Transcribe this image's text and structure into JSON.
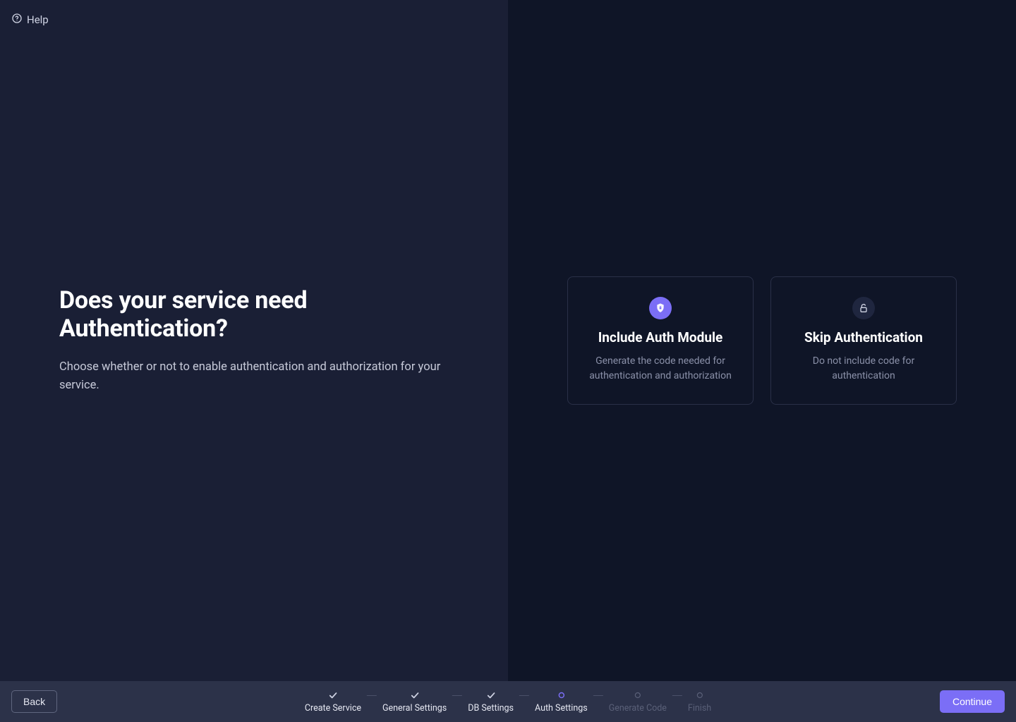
{
  "help": {
    "label": "Help"
  },
  "left_panel": {
    "heading": "Does your service need Authentication?",
    "subheading": "Choose whether or not to enable authentication and authorization for  your service."
  },
  "options": {
    "include": {
      "title": "Include Auth Module",
      "desc": "Generate the code needed for authentication and authorization"
    },
    "skip": {
      "title": "Skip Authentication",
      "desc": "Do not include code for authentication"
    }
  },
  "footer": {
    "back_label": "Back",
    "continue_label": "Continue"
  },
  "steps": [
    {
      "label": "Create Service",
      "state": "done"
    },
    {
      "label": "General Settings",
      "state": "done"
    },
    {
      "label": "DB Settings",
      "state": "done"
    },
    {
      "label": "Auth Settings",
      "state": "current"
    },
    {
      "label": "Generate Code",
      "state": "future"
    },
    {
      "label": "Finish",
      "state": "future"
    }
  ],
  "colors": {
    "accent": "#7b6ef6"
  }
}
